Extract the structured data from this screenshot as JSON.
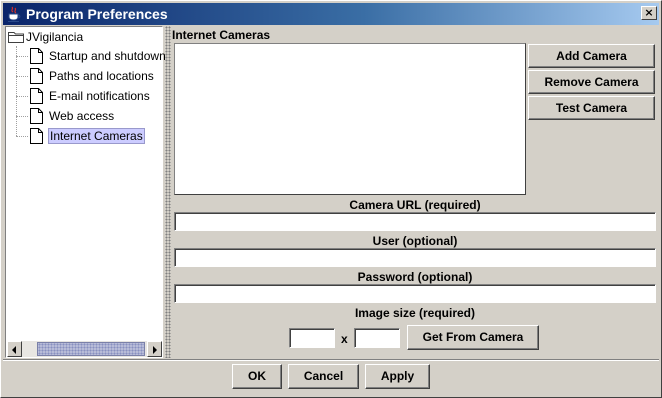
{
  "window": {
    "title": "Program Preferences",
    "close_glyph": "×",
    "app_icon": "java-cup-icon"
  },
  "tree": {
    "root": {
      "label": "JVigilancia",
      "icon": "folder-icon"
    },
    "items": [
      {
        "label": "Startup and shutdown",
        "icon": "document-icon"
      },
      {
        "label": "Paths and locations",
        "icon": "document-icon"
      },
      {
        "label": "E-mail notifications",
        "icon": "document-icon"
      },
      {
        "label": "Web access",
        "icon": "document-icon"
      },
      {
        "label": "Internet Cameras",
        "icon": "document-icon",
        "selected": true
      }
    ]
  },
  "cameras": {
    "section_title": "Internet Cameras",
    "list_items": [],
    "buttons": {
      "add": "Add Camera",
      "remove": "Remove Camera",
      "test": "Test Camera"
    },
    "url": {
      "label": "Camera URL (required)",
      "value": ""
    },
    "user": {
      "label": "User (optional)",
      "value": ""
    },
    "password": {
      "label": "Password (optional)",
      "value": ""
    },
    "image_size": {
      "label": "Image size (required)",
      "width": "",
      "height": "",
      "separator": "x",
      "get_button": "Get From Camera"
    }
  },
  "dialog_buttons": {
    "ok": "OK",
    "cancel": "Cancel",
    "apply": "Apply"
  },
  "colors": {
    "titlebar_start": "#0a246a",
    "titlebar_end": "#a6caf0",
    "selection": "#ccccff",
    "face": "#d4d0c8"
  }
}
